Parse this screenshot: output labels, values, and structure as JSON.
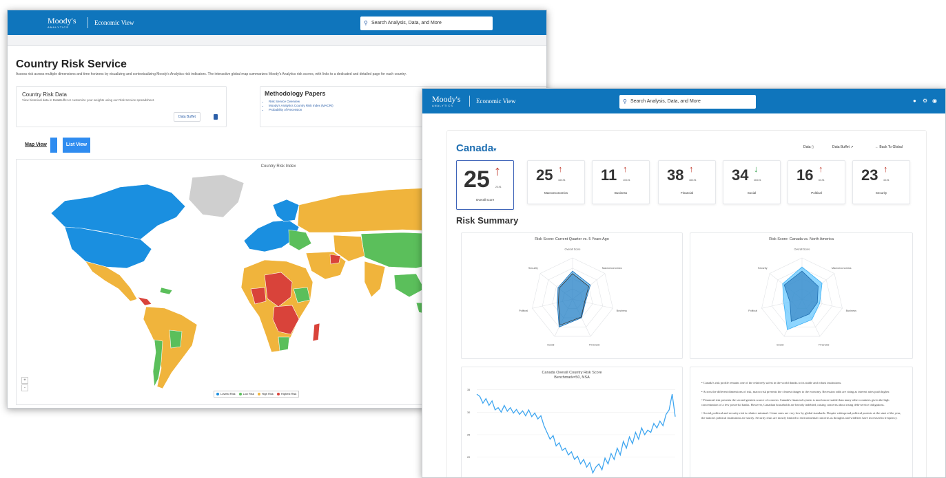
{
  "colors": {
    "header": "#0f75bc",
    "lowest_risk": "#1a8fe0",
    "low_risk": "#5bbf5b",
    "high_risk": "#f0b43c",
    "highest_risk": "#d9433a",
    "no_data": "#cfcfcf",
    "arrow_up": "#c0392b",
    "arrow_down": "#2e9e48"
  },
  "window1": {
    "brand": "Moody's",
    "brand_sub": "ANALYTICS",
    "product": "Economic View",
    "search_placeholder": "Search Analysis, Data, and More",
    "title": "Country Risk Service",
    "description": "Assess risk across multiple dimensions and time horizons by visualizing and contextualizing Moody's Analytics risk indicators. The interactive global map summarizes Moody's Analytics risk scores, with links to a dedicated and detailed page for each country.",
    "data_card": {
      "title": "Country Risk Data",
      "subtitle": "View historical data in DataBuffet or customize your weights using our Risk Service spreadsheet.",
      "button": "Data Buffet"
    },
    "methodology": {
      "title": "Methodology Papers",
      "items": [
        "Risk Service Overview",
        "Moody's Analytics Country Risk Index (MACRI)",
        "Probability of Recession"
      ]
    },
    "tabs": [
      "Map View",
      "List View"
    ],
    "map_title": "Country Risk Index",
    "legend": [
      "Lowest Risk",
      "Low Risk",
      "High Risk",
      "Highest Risk"
    ],
    "zoom": [
      "+",
      "-"
    ]
  },
  "window2": {
    "brand": "Moody's",
    "brand_sub": "ANALYTICS",
    "product": "Economic View",
    "search_placeholder": "Search Analysis, Data, and More",
    "country": "Canada",
    "actions": [
      "Data",
      "Data Buffet",
      "Back To Global"
    ],
    "scores": [
      {
        "value": "25",
        "label": "Overall score",
        "sub": "2/191",
        "direction": "up"
      },
      {
        "value": "25",
        "label": "Macroeconomics",
        "sub": "18/191",
        "direction": "up"
      },
      {
        "value": "11",
        "label": "Business",
        "sub": "10/191",
        "direction": "up"
      },
      {
        "value": "38",
        "label": "Financial",
        "sub": "18/191",
        "direction": "up"
      },
      {
        "value": "34",
        "label": "Social",
        "sub": "46/191",
        "direction": "down"
      },
      {
        "value": "16",
        "label": "Political",
        "sub": "6/191",
        "direction": "up"
      },
      {
        "value": "23",
        "label": "Security",
        "sub": "4/191",
        "direction": "up"
      }
    ],
    "risk_summary": "Risk Summary",
    "radar1": {
      "title": "Risk Score: Current Quarter vs. 5 Years Ago",
      "axes": [
        "Overall Score",
        "Macroeconomics",
        "Business",
        "Financial",
        "Social",
        "Political",
        "Security"
      ]
    },
    "radar2": {
      "title": "Risk Score: Canada vs. North America",
      "axes": [
        "Overall Score",
        "Macroeconomics",
        "Business",
        "Financial",
        "Social",
        "Political",
        "Security"
      ]
    },
    "bullets": [
      "Canada's risk profile remains one of the relatively safest in the world thanks to its stable and robust institutions.",
      "Across the different dimensions of risk, macro risk presents the clearest danger to the economy. Recession odds are rising as interest rates push higher.",
      "Financial risk presents the second greatest source of concern. Canada's financial system is much more stable than many other countries given the high concentration of a few powerful banks. However, Canadian households are heavily indebted, raising concerns about rising debt-service obligations.",
      "Social, political and security risk is relative minimal. Crime rates are very low by global standards. Despite widespread political protests at the start of the year, the nation's political institutions are sturdy. Security risks are mostly limited to environmental concerns as droughts and wildfires have increased in frequency."
    ]
  },
  "chart_data": {
    "type": "line",
    "title": "Canada Overall Country Risk Score",
    "subtitle": "Benchmark=50, NSA",
    "y_ticks": [
      "35",
      "30",
      "25",
      "20",
      "15"
    ],
    "ylim": [
      14,
      36
    ],
    "values": [
      34,
      33.5,
      32,
      33,
      31.5,
      32.5,
      30.5,
      31,
      30,
      31.5,
      30.2,
      31,
      29.8,
      30.6,
      29.5,
      30.3,
      29.2,
      30.5,
      29,
      29.8,
      28.5,
      29.2,
      27,
      25.5,
      24,
      24.8,
      22.5,
      23.2,
      21.5,
      22,
      20.5,
      21.2,
      19.5,
      20.2,
      18.5,
      19.5,
      17.8,
      18.8,
      16.5,
      17.8,
      18.5,
      17.2,
      19.8,
      18.5,
      20.8,
      19.5,
      22,
      20.5,
      23.5,
      22,
      24.5,
      23,
      25.5,
      24,
      26.5,
      25,
      26,
      25.5,
      27.5,
      26.5,
      28,
      27,
      29.5,
      30.5,
      34,
      29
    ]
  }
}
